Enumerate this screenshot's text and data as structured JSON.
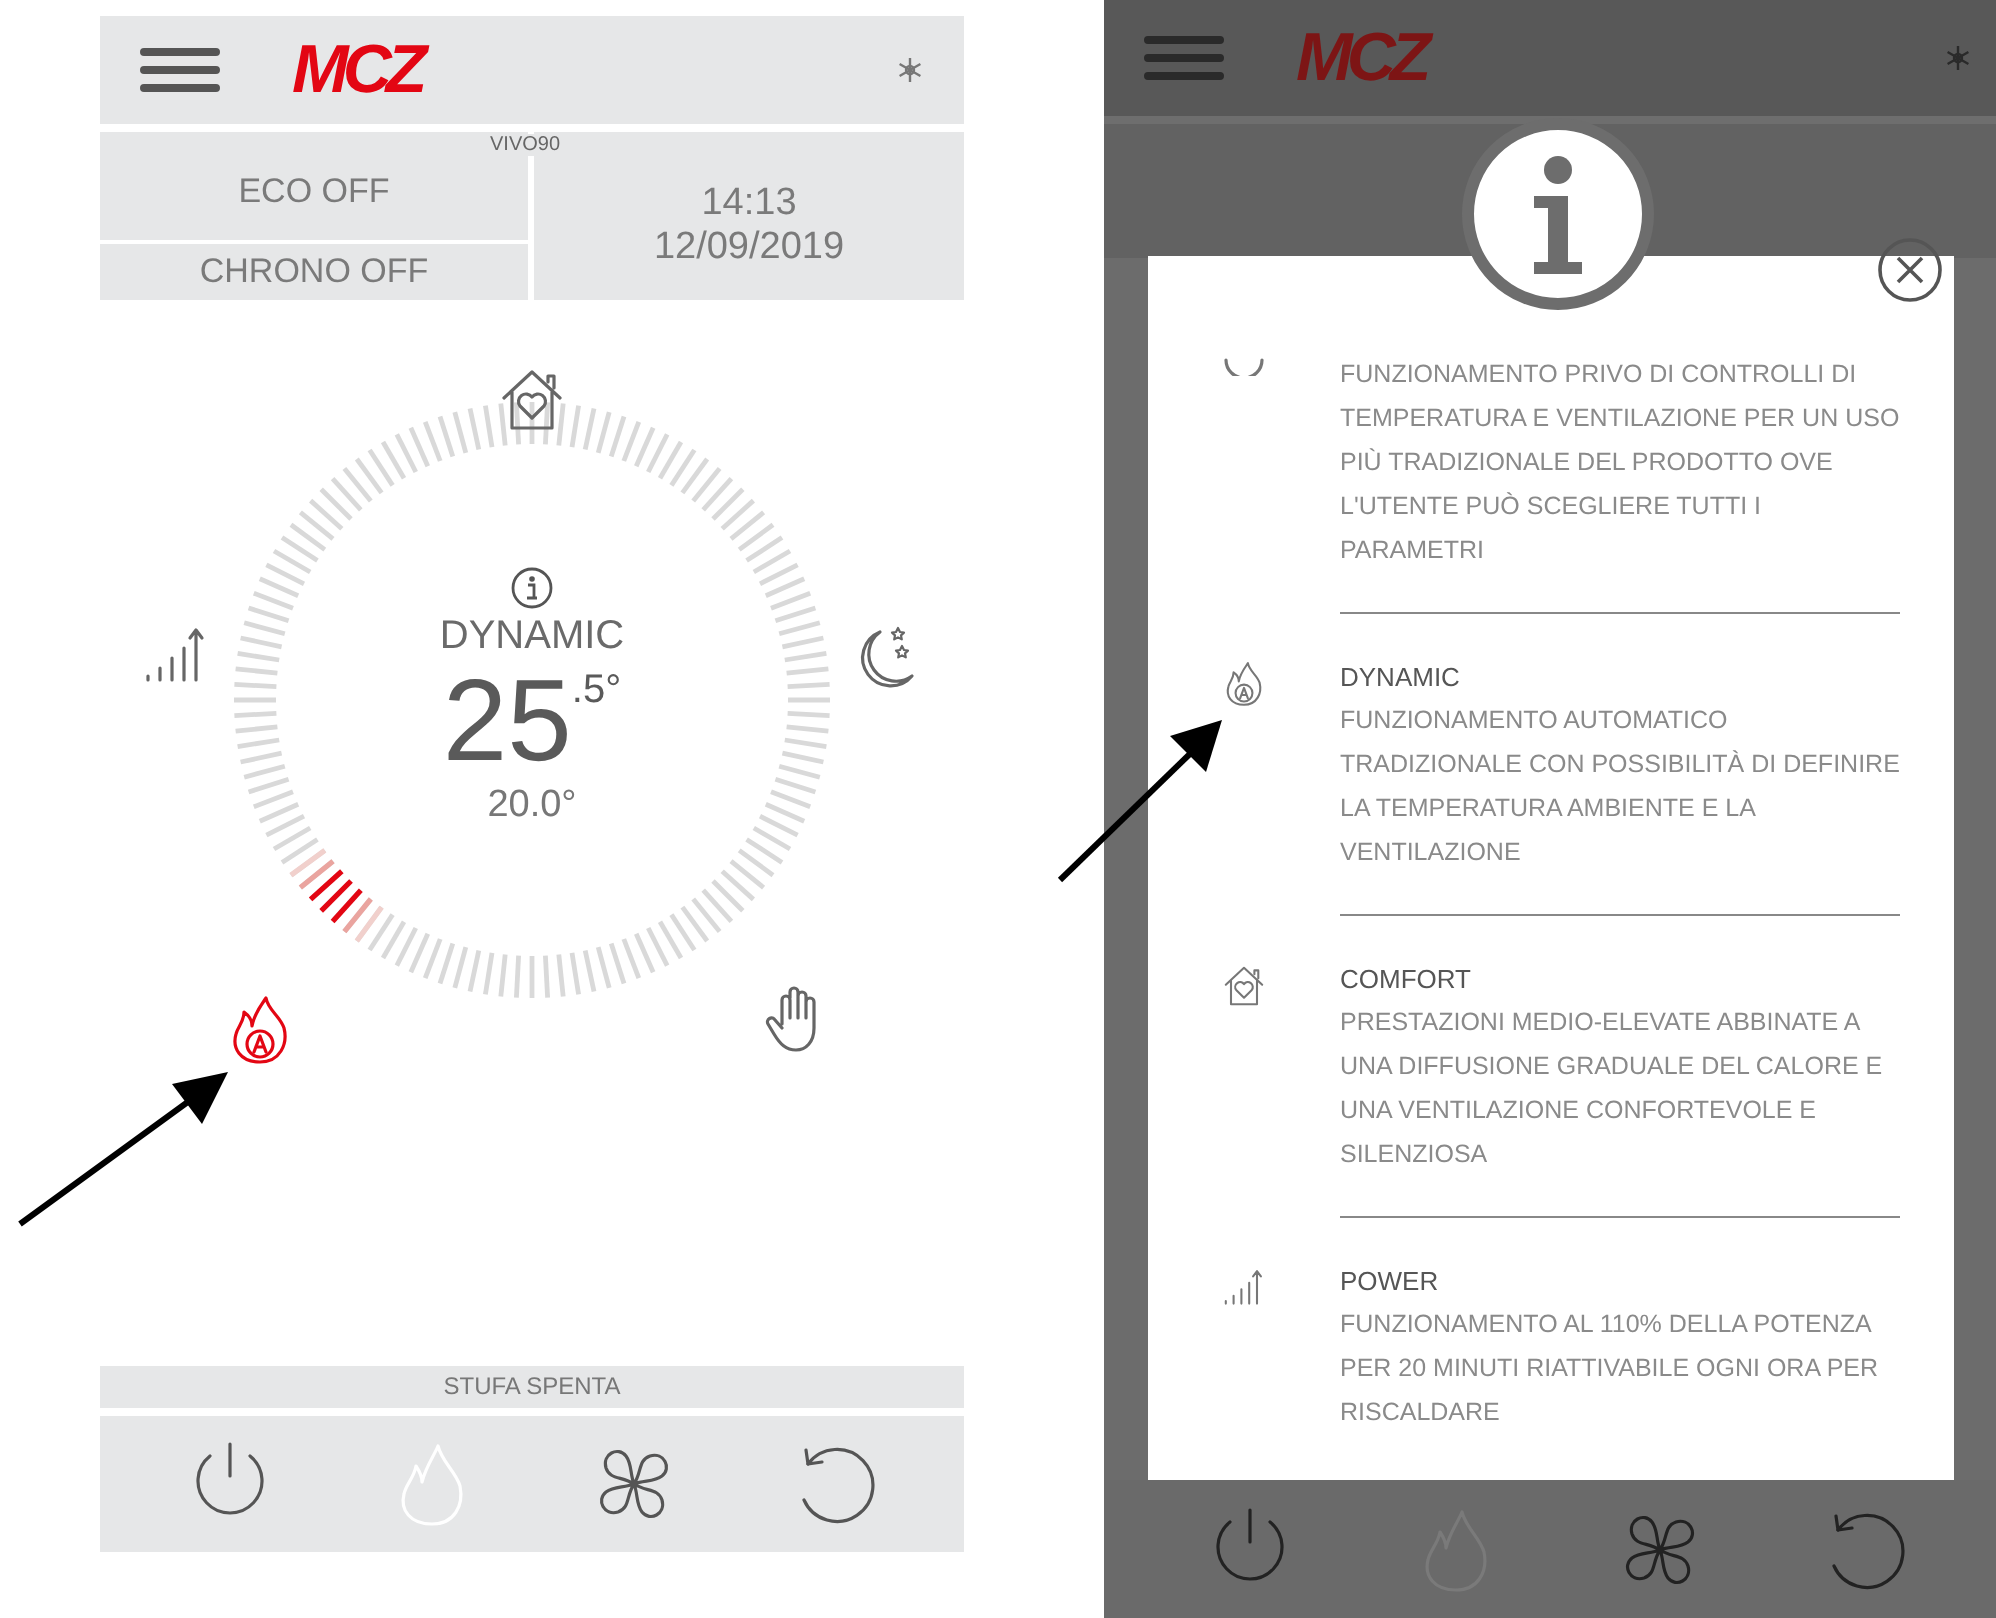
{
  "home_screen": {
    "header": {
      "logo": "MCZ"
    },
    "model": "VIVO90",
    "eco": "ECO OFF",
    "chrono": "CHRONO OFF",
    "time": "14:13",
    "date": "12/09/2019",
    "dial": {
      "level": 0.125
    },
    "mode": "DYNAMIC",
    "temperature": "25$^{.5°}$",
    "setpoint": "20.0°",
    "modes": [
      {
        "kind": "comfort",
        "selected": false
      },
      {
        "kind": "power",
        "selected": false
      },
      {
        "kind": "night",
        "selected": false
      },
      {
        "kind": "dynamic",
        "selected": true
      },
      {
        "kind": "manual",
        "selected": false
      }
    ],
    "status": "STUFA SPENTA",
    "toolbar": [
      {
        "kind": "power",
        "disabled": false
      },
      {
        "kind": "flame",
        "disabled": true
      },
      {
        "kind": "fan",
        "disabled": false
      },
      {
        "kind": "reset",
        "disabled": false
      }
    ]
  },
  "info_screen": {
    "header": {
      "logo": "MCZ"
    },
    "dialog": {
      "entries": [
        {
          "kind": "cut-off",
          "text": "FUNZIONAMENTO PRIVO DI CONTROLLI DI TEMPERATURA E VENTILAZIONE PER UN USO PIÙ TRADIZIONALE DEL PRODOTTO OVE L'UTENTE PUÒ SCEGLIERE TUTTI I PARAMETRI"
        },
        {
          "kind": "dynamic",
          "title": "DYNAMIC",
          "text": "FUNZIONAMENTO AUTOMATICO TRADIZIONALE CON POSSIBILITÀ DI DEFINIRE LA TEMPERATURA AMBIENTE E LA VENTILAZIONE"
        },
        {
          "kind": "comfort",
          "title": "COMFORT",
          "text": "PRESTAZIONI MEDIO-ELEVATE ABBINATE A UNA DIFFUSIONE GRADUALE DEL CALORE E UNA VENTILAZIONE CONFORTEVOLE E SILENZIOSA"
        },
        {
          "kind": "power",
          "title": "POWER",
          "text": "FUNZIONAMENTO AL 110% DELLA POTENZA PER 20 MINUTI RIATTIVABILE OGNI ORA PER RISCALDARE"
        }
      ]
    },
    "toolbar": [
      {
        "kind": "power",
        "disabled": false
      },
      {
        "kind": "flame",
        "disabled": true
      },
      {
        "kind": "fan",
        "disabled": false
      },
      {
        "kind": "reset",
        "disabled": false
      }
    ]
  }
}
